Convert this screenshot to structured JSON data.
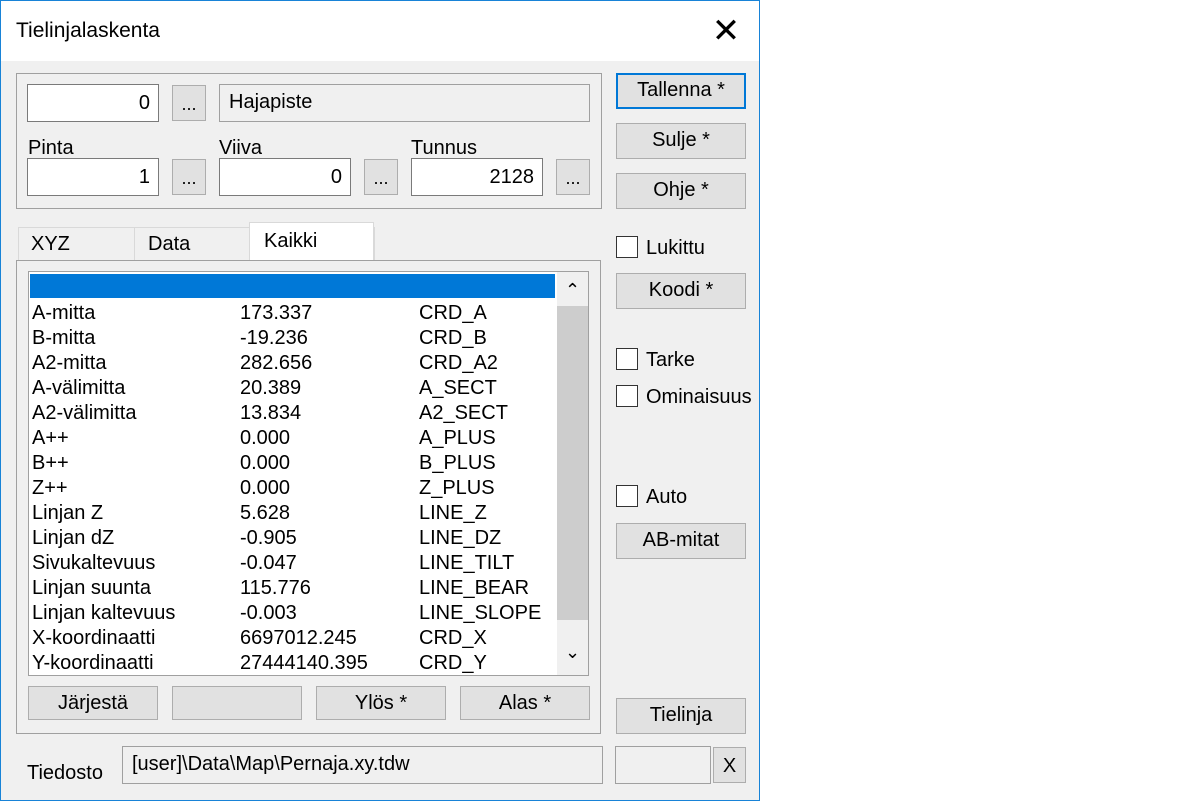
{
  "window": {
    "title": "Tielinjalaskenta",
    "close_glyph": "✕"
  },
  "top": {
    "code_value": "0",
    "code_name": "Hajapiste",
    "pinta_label": "Pinta",
    "pinta_value": "1",
    "viiva_label": "Viiva",
    "viiva_value": "0",
    "tunnus_label": "Tunnus",
    "tunnus_value": "2128",
    "dots": "..."
  },
  "tabs": [
    "XYZ",
    "Data",
    "Kaikki"
  ],
  "list": {
    "rows": [
      {
        "name": "A-mitta",
        "value": "173.337",
        "code": "CRD_A"
      },
      {
        "name": "B-mitta",
        "value": "-19.236",
        "code": "CRD_B"
      },
      {
        "name": "A2-mitta",
        "value": "282.656",
        "code": "CRD_A2"
      },
      {
        "name": "A-välimitta",
        "value": "20.389",
        "code": "A_SECT"
      },
      {
        "name": "A2-välimitta",
        "value": "13.834",
        "code": "A2_SECT"
      },
      {
        "name": "A++",
        "value": "0.000",
        "code": "A_PLUS"
      },
      {
        "name": "B++",
        "value": "0.000",
        "code": "B_PLUS"
      },
      {
        "name": "Z++",
        "value": "0.000",
        "code": "Z_PLUS"
      },
      {
        "name": "Linjan Z",
        "value": "5.628",
        "code": "LINE_Z"
      },
      {
        "name": "Linjan dZ",
        "value": "-0.905",
        "code": "LINE_DZ"
      },
      {
        "name": "Sivukaltevuus",
        "value": "-0.047",
        "code": "LINE_TILT"
      },
      {
        "name": "Linjan suunta",
        "value": "115.776",
        "code": "LINE_BEAR"
      },
      {
        "name": "Linjan kaltevuus",
        "value": "-0.003",
        "code": "LINE_SLOPE"
      },
      {
        "name": "X-koordinaatti",
        "value": "6697012.245",
        "code": "CRD_X"
      },
      {
        "name": "Y-koordinaatti",
        "value": "27444140.395",
        "code": "CRD_Y"
      }
    ],
    "selection_color": "#0078d7",
    "scroll_up": "⌃",
    "scroll_down": "⌄"
  },
  "bottom_buttons": {
    "sort": "Järjestä",
    "blank": "",
    "up": "Ylös *",
    "down": "Alas *"
  },
  "right": {
    "save": "Tallenna *",
    "close": "Sulje *",
    "help": "Ohje *",
    "locked": "Lukittu",
    "code": "Koodi *",
    "tarke": "Tarke",
    "ominaisuus": "Ominaisuus",
    "auto": "Auto",
    "ab": "AB-mitat",
    "tielinja": "Tielinja"
  },
  "file": {
    "label": "Tiedosto",
    "path": "[user]\\Data\\Map\\Pernaja.xy.tdw",
    "x": "X"
  }
}
